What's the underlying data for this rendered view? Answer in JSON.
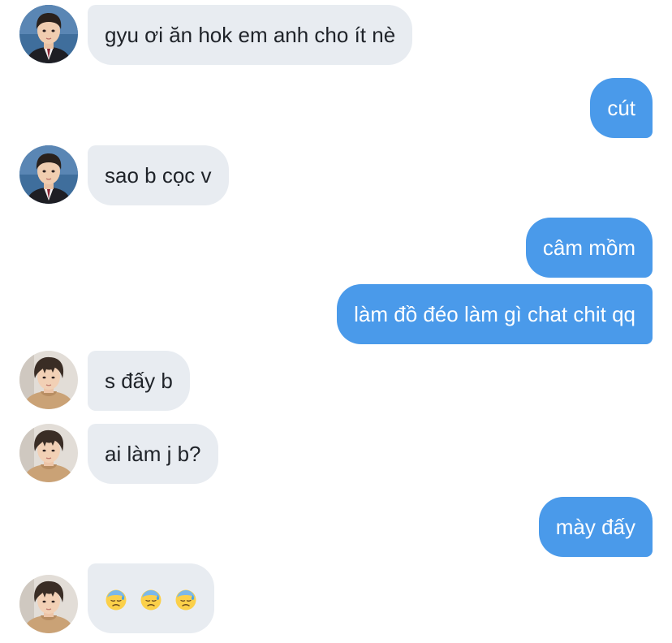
{
  "chat": {
    "messages": [
      {
        "side": "incoming",
        "avatar": "avatar-boy-uniform",
        "text": "gyu ơi ăn hok em anh cho ít nè"
      },
      {
        "side": "outgoing",
        "text": "cút"
      },
      {
        "side": "incoming",
        "avatar": "avatar-boy-uniform",
        "text": "sao b cọc v"
      },
      {
        "side": "outgoing",
        "text": "câm mồm"
      },
      {
        "side": "outgoing",
        "text": "làm đồ đéo làm gì chat chit qq"
      },
      {
        "side": "incoming",
        "avatar": "avatar-boy-hoodie",
        "text": "s đấy b"
      },
      {
        "side": "incoming",
        "avatar": "avatar-boy-hoodie",
        "text": "ai làm j b?"
      },
      {
        "side": "outgoing",
        "text": "mày đấy"
      },
      {
        "side": "incoming",
        "avatar": "avatar-boy-hoodie",
        "emojis": [
          "downcast-face-with-sweat-emoji",
          "downcast-face-with-sweat-emoji",
          "downcast-face-with-sweat-emoji"
        ]
      }
    ]
  },
  "colors": {
    "incoming_bubble": "#e8ecf1",
    "incoming_text": "#1f2329",
    "outgoing_bubble": "#4a9aea",
    "outgoing_text": "#ffffff",
    "background": "#ffffff"
  }
}
